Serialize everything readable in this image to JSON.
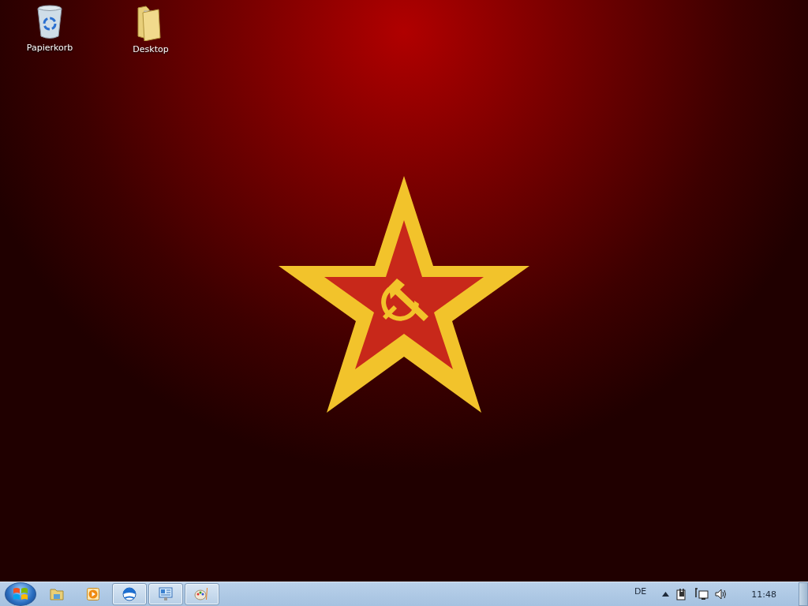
{
  "desktop_icons": [
    {
      "kind": "recycle-bin",
      "label": "Papierkorb"
    },
    {
      "kind": "folder",
      "label": "Desktop"
    }
  ],
  "taskbar": {
    "apps": [
      {
        "kind": "explorer",
        "running": false
      },
      {
        "kind": "media-player",
        "running": false
      },
      {
        "kind": "globe",
        "running": true
      },
      {
        "kind": "presentation",
        "running": true
      },
      {
        "kind": "paint",
        "running": true
      }
    ],
    "tray": {
      "language": "DE",
      "clock": "11:48"
    }
  }
}
